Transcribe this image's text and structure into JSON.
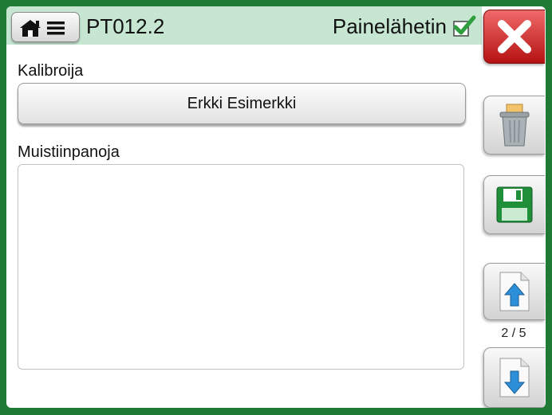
{
  "header": {
    "menu_icons": [
      "home-icon",
      "menu-icon"
    ],
    "title": "PT012.2",
    "subtitle": "Painelähetin",
    "status_icon": "check-icon"
  },
  "calibrator": {
    "label": "Kalibroija",
    "value": "Erkki Esimerkki"
  },
  "notes": {
    "label": "Muistiinpanoja",
    "value": ""
  },
  "sidebar": {
    "buttons": [
      "close-icon",
      "trash-icon",
      "save-icon",
      "page-up-icon",
      "page-down-icon"
    ],
    "page_indicator": "2 / 5"
  },
  "colors": {
    "frame": "#1f7a35",
    "header_bg": "#c6e6d2",
    "close_red": "#d42020",
    "arrow_blue": "#2d8fd8"
  }
}
